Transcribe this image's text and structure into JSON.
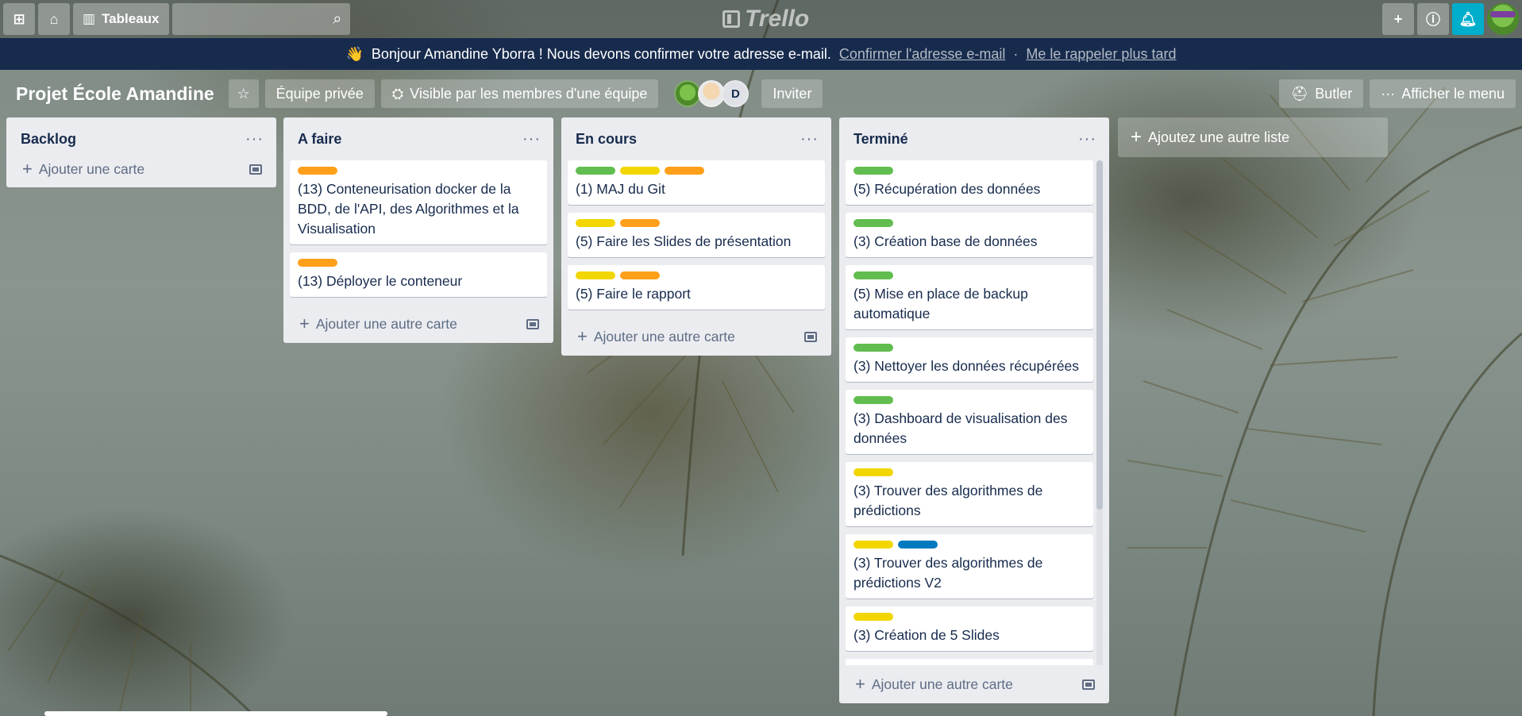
{
  "header": {
    "boards_label": "Tableaux",
    "logo_text": "Trello",
    "search_placeholder": ""
  },
  "banner": {
    "emoji": "👋",
    "message": "Bonjour Amandine Yborra ! Nous devons confirmer votre adresse e-mail.",
    "confirm_link": "Confirmer l'adresse e-mail",
    "separator": "·",
    "later_link": "Me le rappeler plus tard"
  },
  "board": {
    "title": "Projet École Amandine",
    "team_label": "Équipe privée",
    "visibility_label": "Visible par les membres d'une équipe",
    "member_initial": "D",
    "invite_label": "Inviter",
    "butler_label": "Butler",
    "menu_label": "Afficher le menu"
  },
  "lists": [
    {
      "title": "Backlog",
      "add_label": "Ajouter une carte",
      "cards": []
    },
    {
      "title": "A faire",
      "add_label": "Ajouter une autre carte",
      "cards": [
        {
          "labels": [
            "orange"
          ],
          "text": "(13) Conteneurisation docker de la BDD, de l'API, des Algorithmes et la Visualisation"
        },
        {
          "labels": [
            "orange"
          ],
          "text": "(13) Déployer le conteneur"
        }
      ]
    },
    {
      "title": "En cours",
      "add_label": "Ajouter une autre carte",
      "cards": [
        {
          "labels": [
            "green",
            "yellow",
            "orange"
          ],
          "text": "(1) MAJ du Git"
        },
        {
          "labels": [
            "yellow",
            "orange"
          ],
          "text": "(5) Faire les Slides de présentation"
        },
        {
          "labels": [
            "yellow",
            "orange"
          ],
          "text": "(5) Faire le rapport"
        }
      ]
    },
    {
      "title": "Terminé",
      "add_label": "Ajouter une autre carte",
      "cards": [
        {
          "labels": [
            "green"
          ],
          "text": "(5) Récupération des données"
        },
        {
          "labels": [
            "green"
          ],
          "text": "(3) Création base de données"
        },
        {
          "labels": [
            "green"
          ],
          "text": "(5) Mise en place de backup automatique"
        },
        {
          "labels": [
            "green"
          ],
          "text": "(3) Nettoyer les données récupérées"
        },
        {
          "labels": [
            "green"
          ],
          "text": "(3) Dashboard de visualisation des données"
        },
        {
          "labels": [
            "yellow"
          ],
          "text": "(3) Trouver des algorithmes de prédictions"
        },
        {
          "labels": [
            "yellow",
            "blue"
          ],
          "text": "(3) Trouver des algorithmes de prédictions V2"
        },
        {
          "labels": [
            "yellow"
          ],
          "text": "(3) Création de 5 Slides"
        }
      ]
    }
  ],
  "add_list_label": "Ajoutez une autre liste",
  "colors": {
    "banner_bg": "#172b4d",
    "notify_button": "#00aecc",
    "list_bg": "#ebecf0",
    "label_green": "#61bd4f",
    "label_yellow": "#f2d600",
    "label_orange": "#ff9f1a",
    "label_blue": "#0079bf"
  }
}
